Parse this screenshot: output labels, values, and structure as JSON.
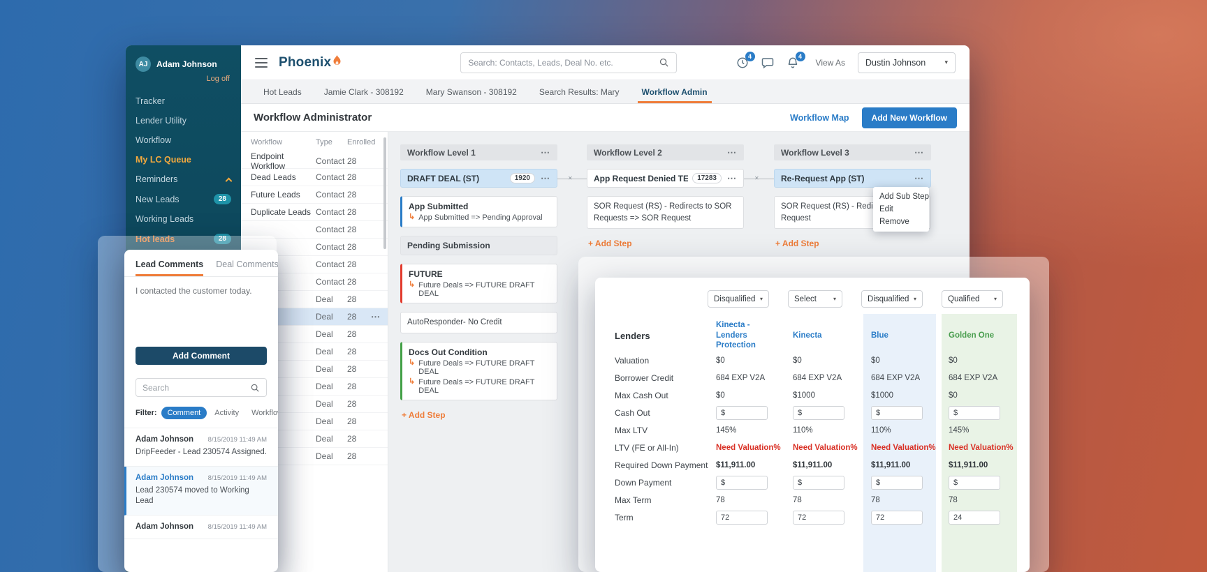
{
  "colors": {
    "accent_blue": "#2a7cc7",
    "accent_orange": "#ef7d3a",
    "navy": "#1c4a68",
    "sidebar_teal": "#0f4e63",
    "badge_teal": "#1f93a8",
    "alert_red": "#d93025",
    "success_green": "#43a047",
    "highlight_blue": "#cfe4f6"
  },
  "sidebar": {
    "initials": "AJ",
    "user_name": "Adam Johnson",
    "logoff": "Log off",
    "items": [
      {
        "label": "Tracker"
      },
      {
        "label": "Lender Utility"
      },
      {
        "label": "Workflow"
      },
      {
        "label": "My LC Queue",
        "state": "active"
      },
      {
        "label": "Reminders",
        "chevron": true
      },
      {
        "label": "New Leads",
        "badge": "28"
      },
      {
        "label": "Working Leads"
      },
      {
        "label": "Hot leads",
        "state": "hot",
        "badge": "28"
      }
    ]
  },
  "header": {
    "logo_text": "Phoenix",
    "search_placeholder": "Search: Contacts, Leads, Deal No. etc.",
    "notif_clock_badge": "4",
    "notif_bell_badge": "4",
    "view_as_label": "View As",
    "view_as_value": "Dustin Johnson"
  },
  "tabs": [
    {
      "label": "Hot Leads"
    },
    {
      "label": "Jamie Clark - 308192"
    },
    {
      "label": "Mary Swanson - 308192"
    },
    {
      "label": "Search Results: Mary"
    },
    {
      "label": "Workflow Admin",
      "active": true
    }
  ],
  "page_header": {
    "title": "Workflow Administrator",
    "map_link": "Workflow Map",
    "add_button": "Add New Workflow"
  },
  "workflow_list": {
    "columns": [
      "Workflow",
      "Type",
      "Enrolled"
    ],
    "rows": [
      {
        "name": "Endpoint Workflow",
        "type": "Contact",
        "enrolled": "28"
      },
      {
        "name": "Dead Leads",
        "type": "Contact",
        "enrolled": "28"
      },
      {
        "name": "Future Leads",
        "type": "Contact",
        "enrolled": "28"
      },
      {
        "name": "Duplicate Leads",
        "type": "Contact",
        "enrolled": "28"
      },
      {
        "name": "",
        "type": "Contact",
        "enrolled": "28"
      },
      {
        "name": "",
        "type": "Contact",
        "enrolled": "28"
      },
      {
        "name": "",
        "type": "Contact",
        "enrolled": "28"
      },
      {
        "name": "",
        "type": "Contact",
        "enrolled": "28"
      },
      {
        "name": "",
        "type": "Deal",
        "enrolled": "28"
      },
      {
        "name": "",
        "type": "Deal",
        "enrolled": "28",
        "selected": true,
        "menu": true
      },
      {
        "name": "",
        "type": "Deal",
        "enrolled": "28"
      },
      {
        "name": "",
        "type": "Deal",
        "enrolled": "28"
      },
      {
        "name": "",
        "type": "Deal",
        "enrolled": "28"
      },
      {
        "name": "",
        "type": "Deal",
        "enrolled": "28"
      },
      {
        "name": "",
        "type": "Deal",
        "enrolled": "28"
      },
      {
        "name": "",
        "type": "Deal",
        "enrolled": "28"
      },
      {
        "name": "",
        "type": "Deal",
        "enrolled": "28"
      },
      {
        "name": "",
        "type": "Deal",
        "enrolled": "28"
      }
    ]
  },
  "board": {
    "columns": [
      {
        "title": "Workflow Level 1",
        "add_step": "+ Add Step",
        "steps": [
          {
            "kind": "stage",
            "title": "DRAFT DEAL (ST)",
            "count": "1920",
            "highlight": true,
            "menu": true
          },
          {
            "kind": "card",
            "accent": "blue",
            "title": "App Submitted",
            "lines": [
              "App Submitted => Pending Approval"
            ]
          },
          {
            "kind": "gray",
            "title": "Pending Submission"
          },
          {
            "kind": "card",
            "accent": "red",
            "title": "FUTURE",
            "lines": [
              "Future Deals => FUTURE DRAFT DEAL"
            ]
          },
          {
            "kind": "plain",
            "title": "AutoResponder- No Credit"
          },
          {
            "kind": "card",
            "accent": "green",
            "title": "Docs Out Condition",
            "lines": [
              "Future Deals => FUTURE DRAFT DEAL",
              "Future Deals => FUTURE DRAFT DEAL"
            ]
          }
        ]
      },
      {
        "title": "Workflow Level 2",
        "add_step": "+ Add Step",
        "steps": [
          {
            "kind": "stage",
            "title": "App Request Denied TEST (ST)",
            "count": "17283",
            "menu": true
          },
          {
            "kind": "plain",
            "title": "SOR Request (RS) - Redirects to SOR Requests => SOR Request"
          }
        ]
      },
      {
        "title": "Workflow Level 3",
        "add_step": "+ Add Step",
        "steps": [
          {
            "kind": "stage",
            "title": "Re-Request App (ST)",
            "highlight": true,
            "menu": true
          },
          {
            "kind": "plain",
            "title": "SOR Request (RS) - Redirects to SOR Request"
          }
        ]
      }
    ],
    "context_menu": [
      "Add Sub Step",
      "Edit",
      "Remove"
    ]
  },
  "comments_panel": {
    "tabs": [
      {
        "label": "Lead Comments",
        "active": true
      },
      {
        "label": "Deal Comments"
      }
    ],
    "draft_text": "I contacted the customer today.",
    "add_button": "Add Comment",
    "search_placeholder": "Search",
    "filter_label": "Filter:",
    "filters": [
      {
        "label": "Comment",
        "active": true
      },
      {
        "label": "Activity"
      },
      {
        "label": "Workflow"
      }
    ],
    "comments": [
      {
        "author": "Adam Johnson",
        "date": "8/15/2019 11:49 AM",
        "text": "DripFeeder - Lead 230574 Assigned."
      },
      {
        "author": "Adam Johnson",
        "date": "8/15/2019 11:49 AM",
        "text": "Lead 230574 moved to Working Lead",
        "selected": true
      },
      {
        "author": "Adam Johnson",
        "date": "8/15/2019 11:49 AM",
        "text": ""
      }
    ]
  },
  "lenders_panel": {
    "title": "Lenders",
    "dropdowns": [
      "Disqualified",
      "Select",
      "Disqualified",
      "Qualified"
    ],
    "columns": [
      {
        "name": "Kinecta - Lenders Protection",
        "theme": "blue"
      },
      {
        "name": "Kinecta",
        "theme": "blue"
      },
      {
        "name": "Blue",
        "theme": "blue",
        "shaded": "blue"
      },
      {
        "name": "Golden One",
        "theme": "green",
        "shaded": "green"
      }
    ],
    "rows": [
      {
        "label": "Valuation",
        "type": "text",
        "values": [
          "$0",
          "$0",
          "$0",
          "$0"
        ]
      },
      {
        "label": "Borrower Credit",
        "type": "text",
        "values": [
          "684 EXP V2A",
          "684 EXP V2A",
          "684 EXP V2A",
          "684 EXP V2A"
        ]
      },
      {
        "label": "Max Cash Out",
        "type": "text",
        "values": [
          "$0",
          "$1000",
          "$1000",
          "$0"
        ]
      },
      {
        "label": "Cash Out",
        "type": "input",
        "values": [
          "$",
          "$",
          "$",
          "$"
        ]
      },
      {
        "label": "Max LTV",
        "type": "text",
        "values": [
          "145%",
          "110%",
          "110%",
          "145%"
        ]
      },
      {
        "label": "LTV (FE or All-In)",
        "type": "alert",
        "values": [
          "Need Valuation%",
          "Need Valuation%",
          "Need Valuation%",
          "Need Valuation%"
        ]
      },
      {
        "label": "Required Down Payment",
        "type": "bold",
        "values": [
          "$11,911.00",
          "$11,911.00",
          "$11,911.00",
          "$11,911.00"
        ]
      },
      {
        "label": "Down Payment",
        "type": "input",
        "values": [
          "$",
          "$",
          "$",
          "$"
        ]
      },
      {
        "label": "Max Term",
        "type": "text",
        "values": [
          "78",
          "78",
          "78",
          "78"
        ]
      },
      {
        "label": "Term",
        "type": "input",
        "values": [
          "72",
          "72",
          "72",
          "24"
        ]
      }
    ]
  }
}
